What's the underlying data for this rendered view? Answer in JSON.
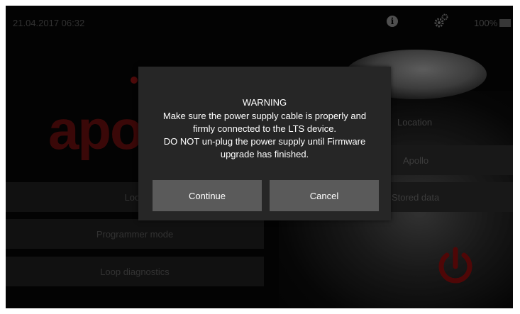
{
  "status_bar": {
    "datetime": "21.04.2017 06:32",
    "battery": "100%",
    "icons": [
      "info-icon",
      "gear-icon",
      "battery-icon"
    ]
  },
  "brand": {
    "logo_text": "apo"
  },
  "menu_left": [
    {
      "label": "Loop"
    },
    {
      "label": "Programmer mode"
    },
    {
      "label": "Loop diagnostics"
    }
  ],
  "menu_right": {
    "location_label": "Location",
    "location_value": "Apollo",
    "stored_data": "Stored data"
  },
  "dialog": {
    "title": "WARNING",
    "message_line1": "Make sure the power supply cable is properly and",
    "message_line2": "firmly connected to the LTS device.",
    "message_line3": "DO NOT un-plug the power supply until Firmware",
    "message_line4": "upgrade has finished.",
    "continue_label": "Continue",
    "cancel_label": "Cancel"
  },
  "colors": {
    "dialog_bg": "#262626",
    "button_bg": "#5a5a5a",
    "brand_red": "#7a1010"
  }
}
